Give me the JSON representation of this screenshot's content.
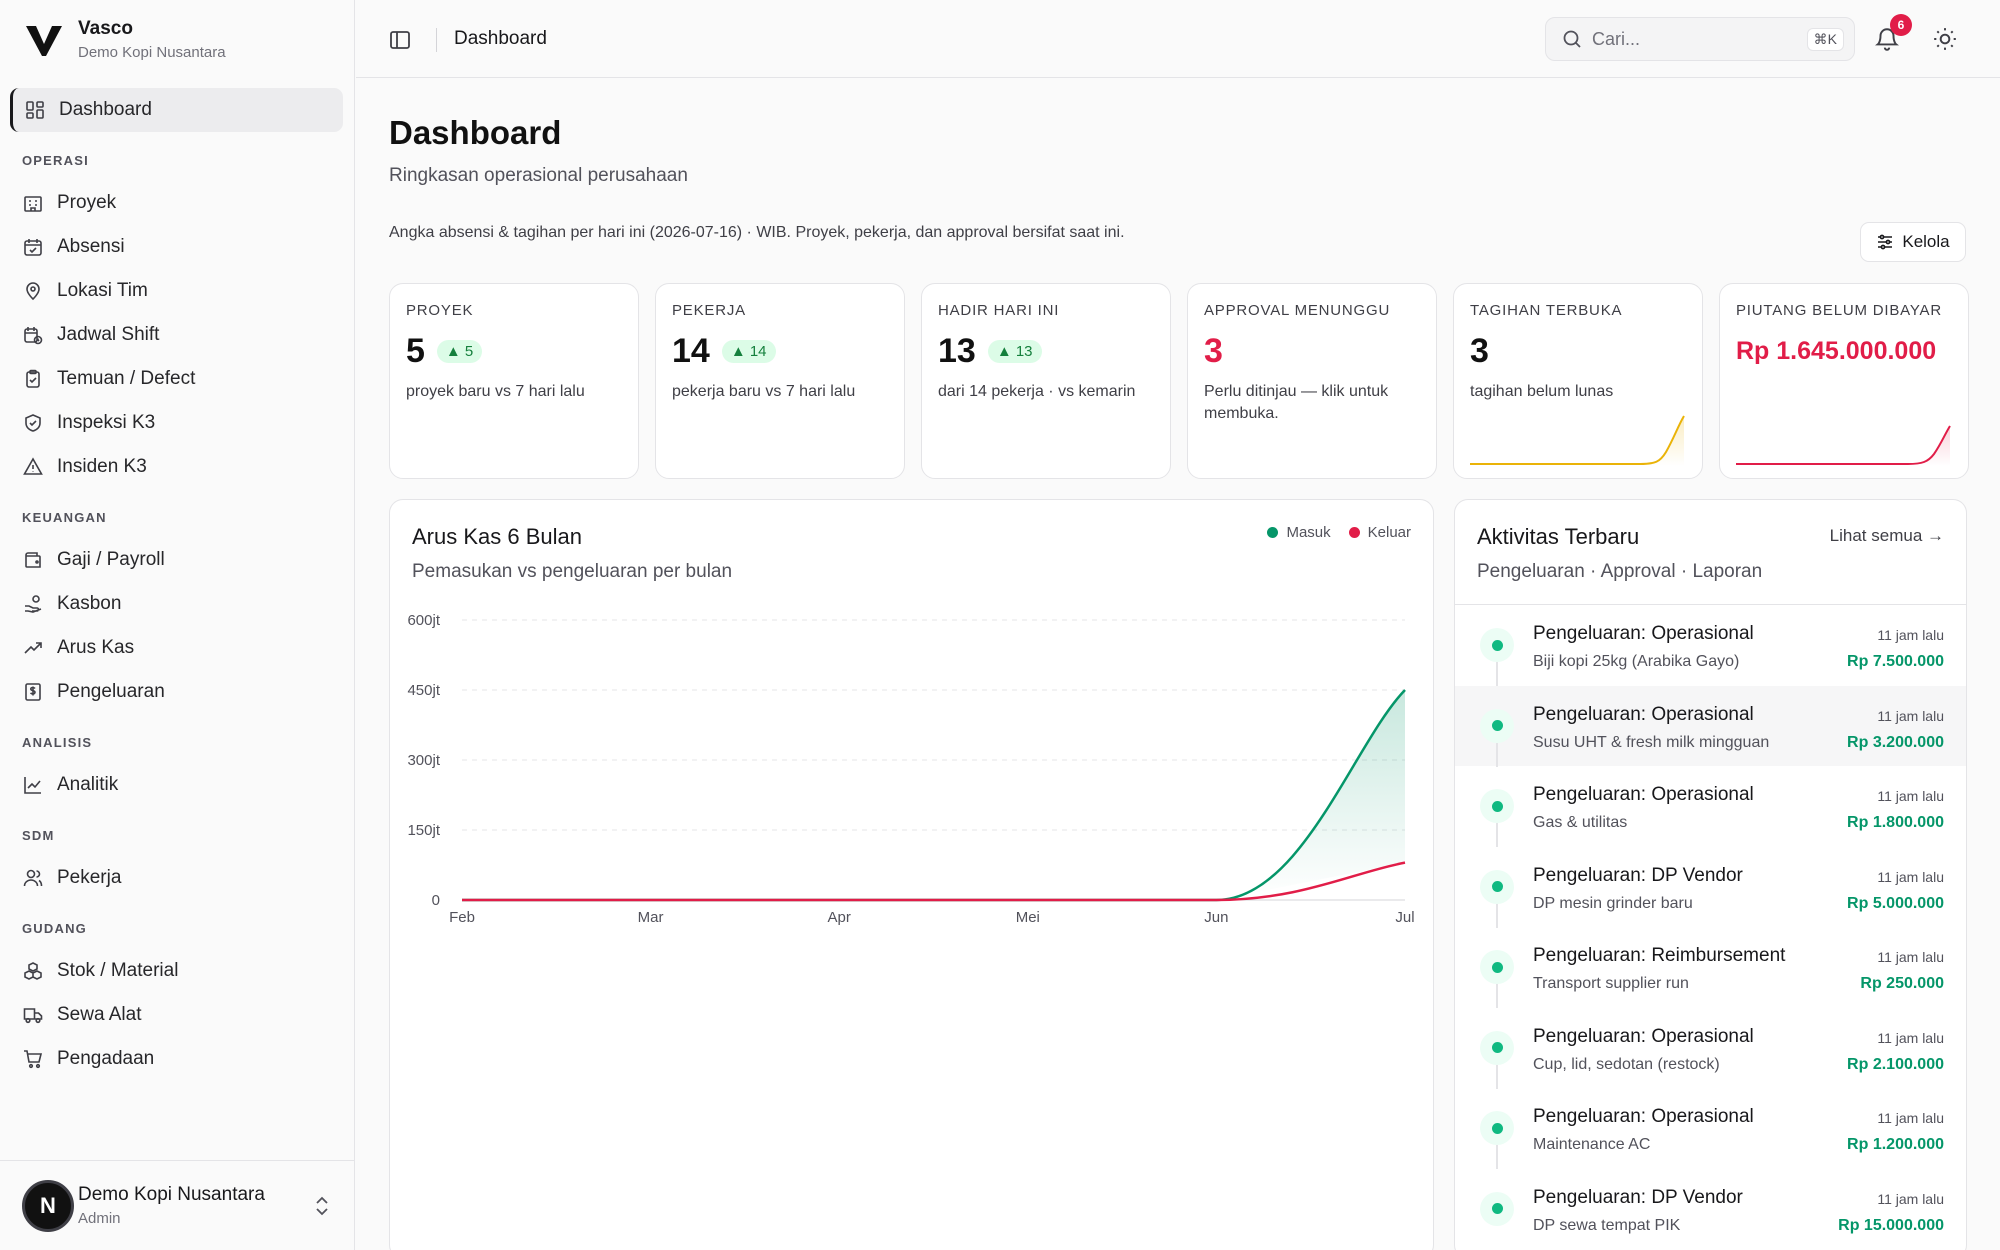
{
  "brand": {
    "name": "Vasco",
    "sub": "Demo Kopi Nusantara"
  },
  "sidebar": {
    "dashboard": "Dashboard",
    "sections": {
      "operasi": "OPERASI",
      "keuangan": "KEUANGAN",
      "analisis": "ANALISIS",
      "sdm": "SDM",
      "gudang": "GUDANG"
    },
    "items": {
      "proyek": "Proyek",
      "absensi": "Absensi",
      "lokasi": "Lokasi Tim",
      "jadwal": "Jadwal Shift",
      "temuan": "Temuan / Defect",
      "inspeksi": "Inspeksi K3",
      "insiden": "Insiden K3",
      "gaji": "Gaji / Payroll",
      "kasbon": "Kasbon",
      "aruskas": "Arus Kas",
      "pengeluaran": "Pengeluaran",
      "analitik": "Analitik",
      "pekerja": "Pekerja",
      "stok": "Stok / Material",
      "sewa": "Sewa Alat",
      "pengadaan": "Pengadaan"
    },
    "footer": {
      "avatar": "N",
      "name": "Demo Kopi Nusantara",
      "role": "Admin"
    }
  },
  "topbar": {
    "title": "Dashboard",
    "search_placeholder": "Cari...",
    "search_shortcut": "⌘K",
    "notif_count": "6"
  },
  "page": {
    "title": "Dashboard",
    "subtitle": "Ringkasan operasional perusahaan",
    "note": "Angka absensi & tagihan per hari ini (2026-07-16) · WIB. Proyek, pekerja, dan approval bersifat saat ini.",
    "kelola": "Kelola"
  },
  "kpis": [
    {
      "label": "PROYEK",
      "value": "5",
      "delta": "▲ 5",
      "desc": "proyek baru vs 7 hari lalu"
    },
    {
      "label": "PEKERJA",
      "value": "14",
      "delta": "▲ 14",
      "desc": "pekerja baru vs 7 hari lalu"
    },
    {
      "label": "HADIR HARI INI",
      "value": "13",
      "delta": "▲ 13",
      "desc": "dari 14 pekerja · vs kemarin"
    },
    {
      "label": "APPROVAL MENUNGGU",
      "value": "3",
      "desc": "Perlu ditinjau — klik untuk membuka."
    },
    {
      "label": "TAGIHAN TERBUKA",
      "value": "3",
      "desc": "tagihan belum lunas"
    },
    {
      "label": "PIUTANG BELUM DIBAYAR",
      "value": "Rp 1.645.000.000"
    }
  ],
  "colors": {
    "masuk": "#059669",
    "keluar": "#e11d48",
    "tagihan_spark": "#eab308",
    "piutang_spark": "#e11d48"
  },
  "cashflow": {
    "title": "Arus Kas 6 Bulan",
    "subtitle": "Pemasukan vs pengeluaran per bulan",
    "legend": {
      "masuk": "Masuk",
      "keluar": "Keluar"
    }
  },
  "chart_data": {
    "type": "line",
    "categories": [
      "Feb",
      "Mar",
      "Apr",
      "Mei",
      "Jun",
      "Jul"
    ],
    "y_ticks": [
      "0",
      "150jt",
      "300jt",
      "450jt",
      "600jt"
    ],
    "ylim": [
      0,
      600000000
    ],
    "grid": true,
    "legend_position": "top-right",
    "series": [
      {
        "name": "Masuk",
        "values": [
          0,
          0,
          0,
          0,
          0,
          450000000
        ]
      },
      {
        "name": "Keluar",
        "values": [
          0,
          0,
          0,
          0,
          0,
          80000000
        ]
      }
    ]
  },
  "activity": {
    "title": "Aktivitas Terbaru",
    "subtitle": "Pengeluaran · Approval · Laporan",
    "see_all": "Lihat semua →",
    "items": [
      {
        "title": "Pengeluaran: Operasional",
        "desc": "Biji kopi 25kg (Arabika Gayo)",
        "time": "11 jam lalu",
        "amount": "Rp 7.500.000"
      },
      {
        "title": "Pengeluaran: Operasional",
        "desc": "Susu UHT & fresh milk mingguan",
        "time": "11 jam lalu",
        "amount": "Rp 3.200.000"
      },
      {
        "title": "Pengeluaran: Operasional",
        "desc": "Gas & utilitas",
        "time": "11 jam lalu",
        "amount": "Rp 1.800.000"
      },
      {
        "title": "Pengeluaran: DP Vendor",
        "desc": "DP mesin grinder baru",
        "time": "11 jam lalu",
        "amount": "Rp 5.000.000"
      },
      {
        "title": "Pengeluaran: Reimbursement",
        "desc": "Transport supplier run",
        "time": "11 jam lalu",
        "amount": "Rp 250.000"
      },
      {
        "title": "Pengeluaran: Operasional",
        "desc": "Cup, lid, sedotan (restock)",
        "time": "11 jam lalu",
        "amount": "Rp 2.100.000"
      },
      {
        "title": "Pengeluaran: Operasional",
        "desc": "Maintenance AC",
        "time": "11 jam lalu",
        "amount": "Rp 1.200.000"
      },
      {
        "title": "Pengeluaran: DP Vendor",
        "desc": "DP sewa tempat PIK",
        "time": "11 jam lalu",
        "amount": "Rp 15.000.000"
      }
    ]
  }
}
